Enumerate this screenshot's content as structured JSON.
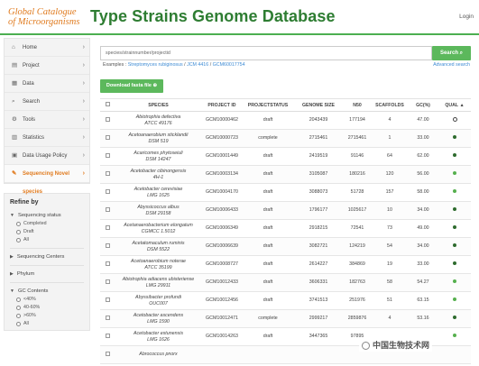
{
  "header": {
    "logo_line1": "Global Catalogue",
    "logo_line2": "of Microorganisms",
    "title": "Type Strains Genome Database",
    "login": "Login"
  },
  "nav": [
    {
      "label": "Home",
      "icon": "home-icon",
      "glyph": "⌂"
    },
    {
      "label": "Project",
      "icon": "project-icon",
      "glyph": "▤"
    },
    {
      "label": "Data",
      "icon": "data-icon",
      "glyph": "▦"
    },
    {
      "label": "Search",
      "icon": "search-icon",
      "glyph": "⌕"
    },
    {
      "label": "Tools",
      "icon": "tools-icon",
      "glyph": "⚙"
    },
    {
      "label": "Statistics",
      "icon": "statistics-icon",
      "glyph": "▥"
    },
    {
      "label": "Data Usage Policy",
      "icon": "policy-icon",
      "glyph": "▣"
    },
    {
      "label": "Sequencing Novel species",
      "icon": "sequencing-icon",
      "glyph": "✎"
    }
  ],
  "refine": {
    "title": "Refine by",
    "sequencing_status": {
      "label": "Sequencing status",
      "options": [
        "Completed",
        "Draft",
        "All"
      ]
    },
    "sequencing_centers": {
      "label": "Sequencing Centers"
    },
    "phylum": {
      "label": "Phylum"
    },
    "gc_contents": {
      "label": "GC Contents",
      "options": [
        "<40%",
        "40-60%",
        ">60%",
        "All"
      ]
    }
  },
  "search": {
    "placeholder": "species/strainnumber/projectid",
    "button": "Search",
    "examples_label": "Examples :",
    "example1": "Streptomyces rubiginosus",
    "sep1": " / ",
    "example2": "JCM 4416",
    "sep2": " / ",
    "example3": "GCM60017754",
    "advanced": "Advanced search"
  },
  "download_button": "Download fasta file",
  "table": {
    "headers": [
      "",
      "SPECIES",
      "PROJECT ID",
      "PROJECTSTATUS",
      "GENOME SIZE",
      "N50",
      "SCAFFOLDS",
      "GC(%)",
      "QUAL"
    ],
    "rows": [
      {
        "species": "Abiotrophia defectiva",
        "strain": "ATCC 49176",
        "id": "GCM10000462",
        "status": "draft",
        "size": "2043439",
        "n50": "177194",
        "scaffolds": "4",
        "gc": "47.00",
        "qual": "hollow"
      },
      {
        "species": "Acetoanaerobium sticklandii",
        "strain": "DSM 519",
        "id": "GCM10000723",
        "status": "complete",
        "size": "2715461",
        "n50": "2715461",
        "scaffolds": "1",
        "gc": "33.00",
        "qual": "dark"
      },
      {
        "species": "Acaricomes phytoseiuli",
        "strain": "DSM 14247",
        "id": "GCM10001449",
        "status": "draft",
        "size": "2419519",
        "n50": "91146",
        "scaffolds": "64",
        "gc": "62.00",
        "qual": "dark"
      },
      {
        "species": "Acetobacter cibinongensis",
        "strain": "4H-1",
        "id": "GCM10003134",
        "status": "draft",
        "size": "3105087",
        "n50": "180216",
        "scaffolds": "120",
        "gc": "56.00",
        "qual": "light"
      },
      {
        "species": "Acetobacter cerevisiae",
        "strain": "LMG 1625",
        "id": "GCM10004170",
        "status": "draft",
        "size": "3088073",
        "n50": "51728",
        "scaffolds": "157",
        "gc": "58.00",
        "qual": "light"
      },
      {
        "species": "Abyssicoccus albus",
        "strain": "DSM 29158",
        "id": "GCM10006433",
        "status": "draft",
        "size": "1796177",
        "n50": "1025617",
        "scaffolds": "10",
        "gc": "34.00",
        "qual": "dark"
      },
      {
        "species": "Acetanaerobacterium elongatum",
        "strain": "CGMCC 1.5012",
        "id": "GCM10006349",
        "status": "draft",
        "size": "2918215",
        "n50": "72541",
        "scaffolds": "73",
        "gc": "49.00",
        "qual": "dark"
      },
      {
        "species": "Acetatomaculum ruminis",
        "strain": "DSM 5522",
        "id": "GCM10006639",
        "status": "draft",
        "size": "3082721",
        "n50": "124219",
        "scaffolds": "54",
        "gc": "34.00",
        "qual": "dark"
      },
      {
        "species": "Acetoanaerobium noterae",
        "strain": "ATCC 35199",
        "id": "GCM10008727",
        "status": "draft",
        "size": "2614227",
        "n50": "384869",
        "scaffolds": "19",
        "gc": "33.00",
        "qual": "dark"
      },
      {
        "species": "Abiotrophia adiacens ubisteriense",
        "strain": "LMG 29911",
        "id": "GCM10012433",
        "status": "draft",
        "size": "3606331",
        "n50": "182763",
        "scaffolds": "58",
        "gc": "54.27",
        "qual": "light"
      },
      {
        "species": "Abyssibacter profundi",
        "strain": "OUC007",
        "id": "GCM10012456",
        "status": "draft",
        "size": "3741513",
        "n50": "251976",
        "scaffolds": "51",
        "gc": "63.15",
        "qual": "light"
      },
      {
        "species": "Acetobacter ascendens",
        "strain": "LMG 1590",
        "id": "GCM10012471",
        "status": "complete",
        "size": "2999217",
        "n50": "2859876",
        "scaffolds": "4",
        "gc": "53.16",
        "qual": "dark"
      },
      {
        "species": "Acetobacter estunensis",
        "strain": "LMG 1626",
        "id": "GCM10014263",
        "status": "draft",
        "size": "3447365",
        "n50": "97895",
        "scaffolds": "",
        "gc": "",
        "qual": "light"
      },
      {
        "species": "Abrococcus pnorx",
        "strain": "",
        "id": "",
        "status": "",
        "size": "",
        "n50": "",
        "scaffolds": "",
        "gc": "",
        "qual": ""
      }
    ]
  },
  "watermark": "中国生物技术网"
}
